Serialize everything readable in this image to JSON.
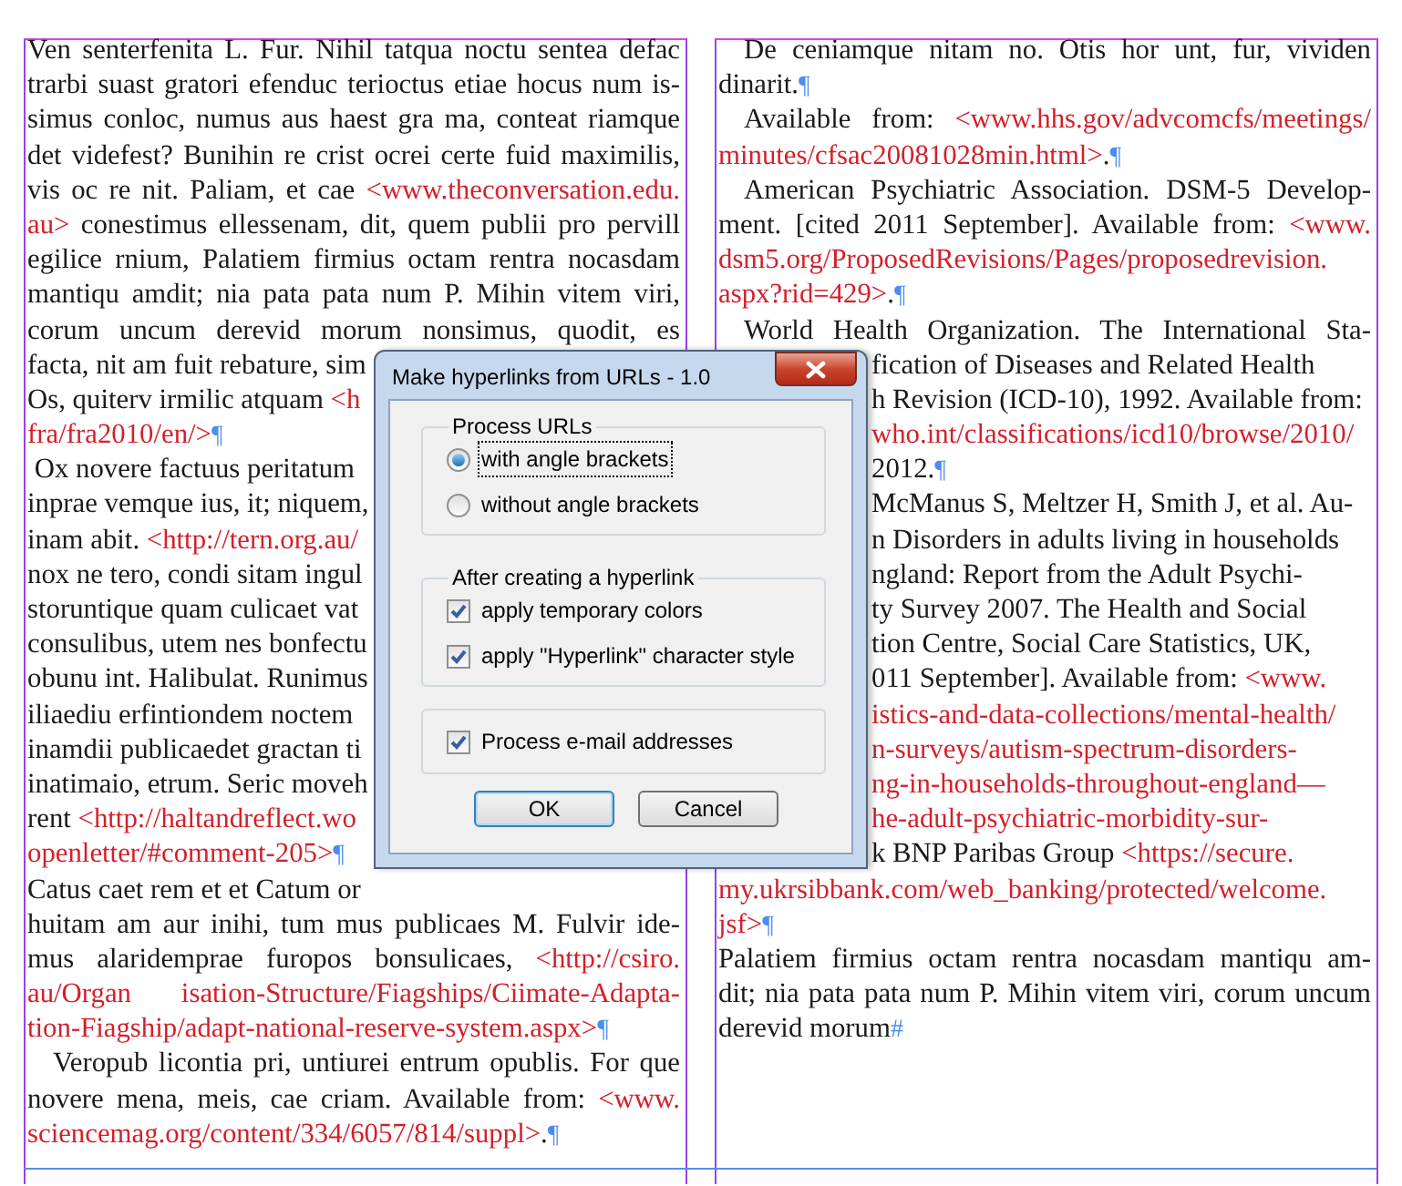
{
  "columns": [
    {
      "lines": [
        {
          "indent": false,
          "segments": [
            {
              "kind": "text",
              "text": "Ven senterfenita L. Fur. Nihil tatqua noctu sentea defac"
            }
          ]
        },
        {
          "indent": false,
          "segments": [
            {
              "kind": "text",
              "text": "trarbi suast gratori efenduc terioctus etiae hocus num is-"
            }
          ]
        },
        {
          "indent": false,
          "segments": [
            {
              "kind": "text",
              "text": "simus conloc, numus aus haest gra ma, conteat riamque"
            }
          ]
        },
        {
          "indent": false,
          "segments": [
            {
              "kind": "text",
              "text": "det videfest? Bunihin re crist ocrei certe fuid maximilis,"
            }
          ]
        },
        {
          "indent": false,
          "segments": [
            {
              "kind": "text",
              "text": "vis oc re nit. Paliam, et cae "
            },
            {
              "kind": "url",
              "text": "<www.theconversation.edu."
            }
          ]
        },
        {
          "indent": false,
          "segments": [
            {
              "kind": "url",
              "text": "au>"
            },
            {
              "kind": "text",
              "text": " conestimus ellessenam, dit, quem publii pro pervill"
            }
          ]
        },
        {
          "indent": false,
          "segments": [
            {
              "kind": "text",
              "text": "egilice rnium, Palatiem firmius octam rentra nocasdam"
            }
          ]
        },
        {
          "indent": false,
          "segments": [
            {
              "kind": "text",
              "text": "mantiqu amdit; nia pata pata num P. Mihin vitem viri,"
            }
          ]
        },
        {
          "indent": false,
          "segments": [
            {
              "kind": "text",
              "text": "corum uncum derevid morum nonsimus, quodit, es"
            }
          ]
        },
        {
          "indent": false,
          "covered_end": true,
          "segments": [
            {
              "kind": "text",
              "text": "facta, nit am fuit rebature, sim"
            }
          ]
        },
        {
          "indent": false,
          "covered_end": true,
          "segments": [
            {
              "kind": "text",
              "text": "Os, quiterv irmilic atquam "
            },
            {
              "kind": "url",
              "text": "<h"
            }
          ]
        },
        {
          "indent": false,
          "segments": [
            {
              "kind": "url",
              "text": "fra/fra2010/en/>"
            },
            {
              "kind": "mark",
              "text": "¶"
            }
          ]
        },
        {
          "indent": false,
          "covered_end": true,
          "segments": [
            {
              "kind": "text",
              "text": " Ox novere factuus peritatum"
            }
          ]
        },
        {
          "indent": false,
          "covered_end": true,
          "segments": [
            {
              "kind": "text",
              "text": "inprae vemque ius, it; niquem,"
            }
          ]
        },
        {
          "indent": false,
          "covered_end": true,
          "segments": [
            {
              "kind": "text",
              "text": "inam abit. "
            },
            {
              "kind": "url",
              "text": "<http://tern.org.au/"
            }
          ]
        },
        {
          "indent": false,
          "covered_end": true,
          "segments": [
            {
              "kind": "text",
              "text": "nox ne tero, condi sitam ingul"
            }
          ]
        },
        {
          "indent": false,
          "covered_end": true,
          "segments": [
            {
              "kind": "text",
              "text": "storuntique quam culicaet vat"
            }
          ]
        },
        {
          "indent": false,
          "covered_end": true,
          "segments": [
            {
              "kind": "text",
              "text": "consulibus, utem nes bonfectu"
            }
          ]
        },
        {
          "indent": false,
          "covered_end": true,
          "segments": [
            {
              "kind": "text",
              "text": "obunu int. Halibulat. Runimus"
            }
          ]
        },
        {
          "indent": false,
          "covered_end": true,
          "segments": [
            {
              "kind": "text",
              "text": "iliaediu erfintiondem noctem"
            }
          ]
        },
        {
          "indent": false,
          "covered_end": true,
          "segments": [
            {
              "kind": "text",
              "text": "inamdii publicaedet gractan ti"
            }
          ]
        },
        {
          "indent": false,
          "covered_end": true,
          "segments": [
            {
              "kind": "text",
              "text": "inatimaio, etrum. Seric moveh"
            }
          ]
        },
        {
          "indent": false,
          "covered_end": true,
          "segments": [
            {
              "kind": "text",
              "text": "rent "
            },
            {
              "kind": "url",
              "text": "<http://haltandreflect.wo"
            }
          ]
        },
        {
          "indent": false,
          "segments": [
            {
              "kind": "url",
              "text": "openletter/#comment-205>"
            },
            {
              "kind": "mark",
              "text": "¶"
            }
          ]
        },
        {
          "indent": false,
          "covered_end": true,
          "segments": [
            {
              "kind": "text",
              "text": "Catus caet rem et et Catum or"
            }
          ]
        },
        {
          "indent": false,
          "segments": [
            {
              "kind": "text",
              "text": "huitam am aur inihi, tum mus publicaes M. Fulvir ide-"
            }
          ]
        },
        {
          "indent": false,
          "segments": [
            {
              "kind": "text",
              "text": "mus alaridemprae furopos bonsulicaes, "
            },
            {
              "kind": "url",
              "text": "<http://csiro."
            }
          ]
        },
        {
          "indent": false,
          "segments": [
            {
              "kind": "url",
              "text": "au/Organ isation-Structure/Fiagships/Ciimate-Adapta-"
            }
          ]
        },
        {
          "indent": false,
          "segments": [
            {
              "kind": "url",
              "text": "tion-Fiagship/adapt-national-reserve-system.aspx>"
            },
            {
              "kind": "mark",
              "text": "¶"
            }
          ]
        },
        {
          "indent": true,
          "segments": [
            {
              "kind": "text",
              "text": "Veropub licontia pri, untiurei entrum opublis. For que"
            }
          ]
        },
        {
          "indent": false,
          "segments": [
            {
              "kind": "text",
              "text": "novere mena, meis, cae criam. Available from: "
            },
            {
              "kind": "url",
              "text": "<www."
            }
          ]
        },
        {
          "indent": false,
          "segments": [
            {
              "kind": "url",
              "text": "sciencemag.org/content/334/6057/814/suppl>"
            },
            {
              "kind": "text",
              "text": "."
            },
            {
              "kind": "mark",
              "text": "¶"
            }
          ]
        }
      ]
    },
    {
      "lines": [
        {
          "indent": true,
          "segments": [
            {
              "kind": "text",
              "text": "De ceniamque nitam no. Otis hor unt, fur, vividen"
            }
          ]
        },
        {
          "indent": false,
          "segments": [
            {
              "kind": "text",
              "text": "dinarit."
            },
            {
              "kind": "mark",
              "text": "¶"
            }
          ]
        },
        {
          "indent": true,
          "segments": [
            {
              "kind": "text",
              "text": "Available from: "
            },
            {
              "kind": "url",
              "text": "<www.hhs.gov/advcomcfs/meetings/"
            }
          ]
        },
        {
          "indent": false,
          "segments": [
            {
              "kind": "url",
              "text": "minutes/cfsac20081028min.html>"
            },
            {
              "kind": "text",
              "text": "."
            },
            {
              "kind": "mark",
              "text": "¶"
            }
          ]
        },
        {
          "indent": true,
          "segments": [
            {
              "kind": "text",
              "text": "American Psychiatric Association. DSM-5 Develop-"
            }
          ]
        },
        {
          "indent": false,
          "segments": [
            {
              "kind": "text",
              "text": "ment. [cited 2011 September]. Available from: "
            },
            {
              "kind": "url",
              "text": "<www."
            }
          ]
        },
        {
          "indent": false,
          "segments": [
            {
              "kind": "url",
              "text": "dsm5.org/ProposedRevisions/Pages/proposedrevision."
            }
          ]
        },
        {
          "indent": false,
          "segments": [
            {
              "kind": "url",
              "text": "aspx?rid=429>"
            },
            {
              "kind": "text",
              "text": "."
            },
            {
              "kind": "mark",
              "text": "¶"
            }
          ]
        },
        {
          "indent": true,
          "segments": [
            {
              "kind": "text",
              "text": "World Health Organization. The International Sta-"
            }
          ]
        },
        {
          "indent": false,
          "covered_start": true,
          "segments": [
            {
              "kind": "text",
              "text": "fication of Diseases and Related Health"
            }
          ]
        },
        {
          "indent": false,
          "covered_start": true,
          "segments": [
            {
              "kind": "text",
              "text": "h Revision (ICD-10), 1992. Available from:"
            }
          ]
        },
        {
          "indent": false,
          "covered_start": true,
          "segments": [
            {
              "kind": "url",
              "text": "who.int/classifications/icd10/browse/2010/"
            }
          ]
        },
        {
          "indent": false,
          "covered_start": true,
          "segments": [
            {
              "kind": "text",
              "text": "2012."
            },
            {
              "kind": "mark",
              "text": "¶"
            }
          ]
        },
        {
          "indent": false,
          "covered_start": true,
          "segments": [
            {
              "kind": "text",
              "text": "McManus S, Meltzer H, Smith J, et al. Au-"
            }
          ]
        },
        {
          "indent": false,
          "covered_start": true,
          "segments": [
            {
              "kind": "text",
              "text": "n Disorders in adults living in households"
            }
          ]
        },
        {
          "indent": false,
          "covered_start": true,
          "segments": [
            {
              "kind": "text",
              "text": "ngland: Report from the Adult Psychi-"
            }
          ]
        },
        {
          "indent": false,
          "covered_start": true,
          "segments": [
            {
              "kind": "text",
              "text": "ty Survey 2007. The Health and Social"
            }
          ]
        },
        {
          "indent": false,
          "covered_start": true,
          "segments": [
            {
              "kind": "text",
              "text": "tion Centre, Social Care Statistics, UK,"
            }
          ]
        },
        {
          "indent": false,
          "covered_start": true,
          "segments": [
            {
              "kind": "text",
              "text": "011 September]. Available from: "
            },
            {
              "kind": "url",
              "text": "<www."
            }
          ]
        },
        {
          "indent": false,
          "covered_start": true,
          "segments": [
            {
              "kind": "url",
              "text": "istics-and-data-collections/mental-health/"
            }
          ]
        },
        {
          "indent": false,
          "covered_start": true,
          "segments": [
            {
              "kind": "url",
              "text": "n-surveys/autism-spectrum-disorders-"
            }
          ]
        },
        {
          "indent": false,
          "covered_start": true,
          "segments": [
            {
              "kind": "url",
              "text": "ng-in-households-throughout-england—"
            }
          ]
        },
        {
          "indent": false,
          "covered_start": true,
          "segments": [
            {
              "kind": "url",
              "text": "he-adult-psychiatric-morbidity-sur-"
            }
          ]
        },
        {
          "indent": false,
          "covered_start": true,
          "segments": [
            {
              "kind": "text",
              "text": "k BNP Paribas Group "
            },
            {
              "kind": "url",
              "text": "<https://secure."
            }
          ]
        },
        {
          "indent": false,
          "segments": [
            {
              "kind": "url",
              "text": "my.ukrsibbank.com/web_banking/protected/welcome."
            }
          ]
        },
        {
          "indent": false,
          "segments": [
            {
              "kind": "url",
              "text": "jsf>"
            },
            {
              "kind": "mark",
              "text": "¶"
            }
          ]
        },
        {
          "indent": false,
          "segments": [
            {
              "kind": "text",
              "text": "Palatiem firmius octam rentra nocasdam mantiqu am-"
            }
          ]
        },
        {
          "indent": false,
          "segments": [
            {
              "kind": "text",
              "text": "dit; nia pata pata num P. Mihin vitem viri, corum uncum"
            }
          ]
        },
        {
          "indent": false,
          "segments": [
            {
              "kind": "text",
              "text": "derevid morum"
            },
            {
              "kind": "mark",
              "text": "#"
            }
          ]
        }
      ]
    }
  ],
  "dialog": {
    "title": "Make hyperlinks from URLs - 1.0",
    "groups": [
      {
        "label": "Process URLs",
        "options": [
          {
            "kind": "radio",
            "label": "with angle brackets",
            "selected": true,
            "focused": true
          },
          {
            "kind": "radio",
            "label": "without angle brackets",
            "selected": false,
            "focused": false
          }
        ]
      },
      {
        "label": "After creating a hyperlink",
        "options": [
          {
            "kind": "checkbox",
            "label": "apply temporary colors",
            "checked": true
          },
          {
            "kind": "checkbox",
            "label": "apply \"Hyperlink\" character style",
            "checked": true
          }
        ]
      },
      {
        "options": [
          {
            "kind": "checkbox",
            "label": "Process e-mail addresses",
            "checked": true
          }
        ]
      }
    ],
    "buttons": [
      {
        "label": "OK",
        "default": true
      },
      {
        "label": "Cancel",
        "default": false
      }
    ]
  }
}
